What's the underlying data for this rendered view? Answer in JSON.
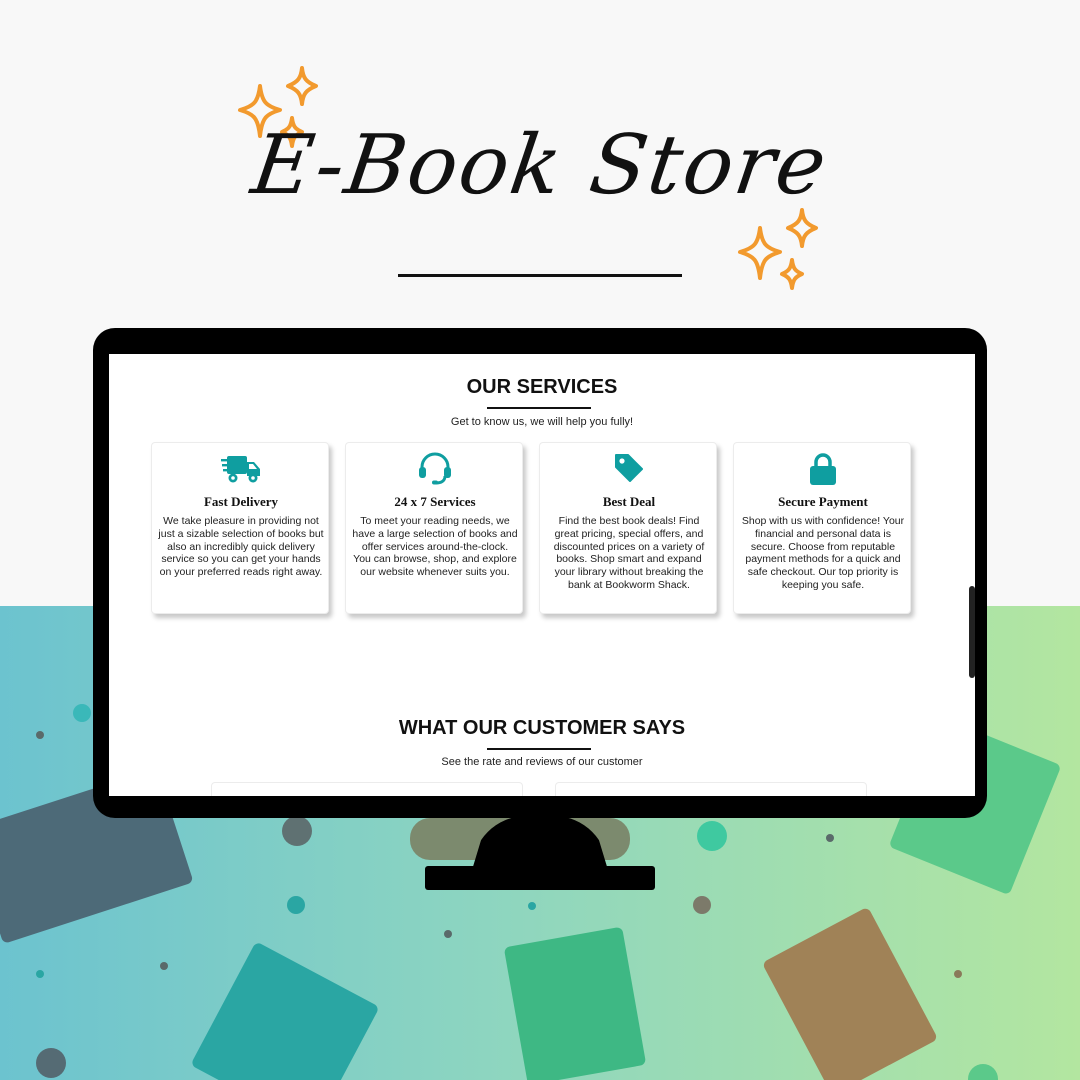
{
  "banner": {
    "title": "E-Book Store"
  },
  "services": {
    "heading": "OUR SERVICES",
    "subtitle": "Get to know us, we will help you fully!",
    "cards": [
      {
        "icon": "delivery-truck-icon",
        "title": "Fast Delivery",
        "text": "We take pleasure in providing not just a sizable selection of books but also an incredibly quick delivery service so you can get your hands on your preferred reads right away."
      },
      {
        "icon": "headset-icon",
        "title": "24 x 7 Services",
        "text": "To meet your reading needs, we have a large selection of books and offer services around-the-clock. You can browse, shop, and explore our website whenever suits you."
      },
      {
        "icon": "price-tag-icon",
        "title": "Best Deal",
        "text": "Find the best book deals! Find great pricing, special offers, and discounted prices on a variety of books. Shop smart and expand your library without breaking the bank at Bookworm Shack."
      },
      {
        "icon": "lock-icon",
        "title": "Secure Payment",
        "text": "Shop with us with confidence! Your financial and personal data is secure. Choose from reputable payment methods for a quick and safe checkout. Our top priority is keeping you safe."
      }
    ]
  },
  "testimonials": {
    "heading": "WHAT OUR CUSTOMER SAYS",
    "subtitle": "See the rate and reviews of our customer"
  },
  "colors": {
    "accent": "#0f9ea0",
    "sparkle": "#f29a2e",
    "background": "#f8f8f8"
  }
}
